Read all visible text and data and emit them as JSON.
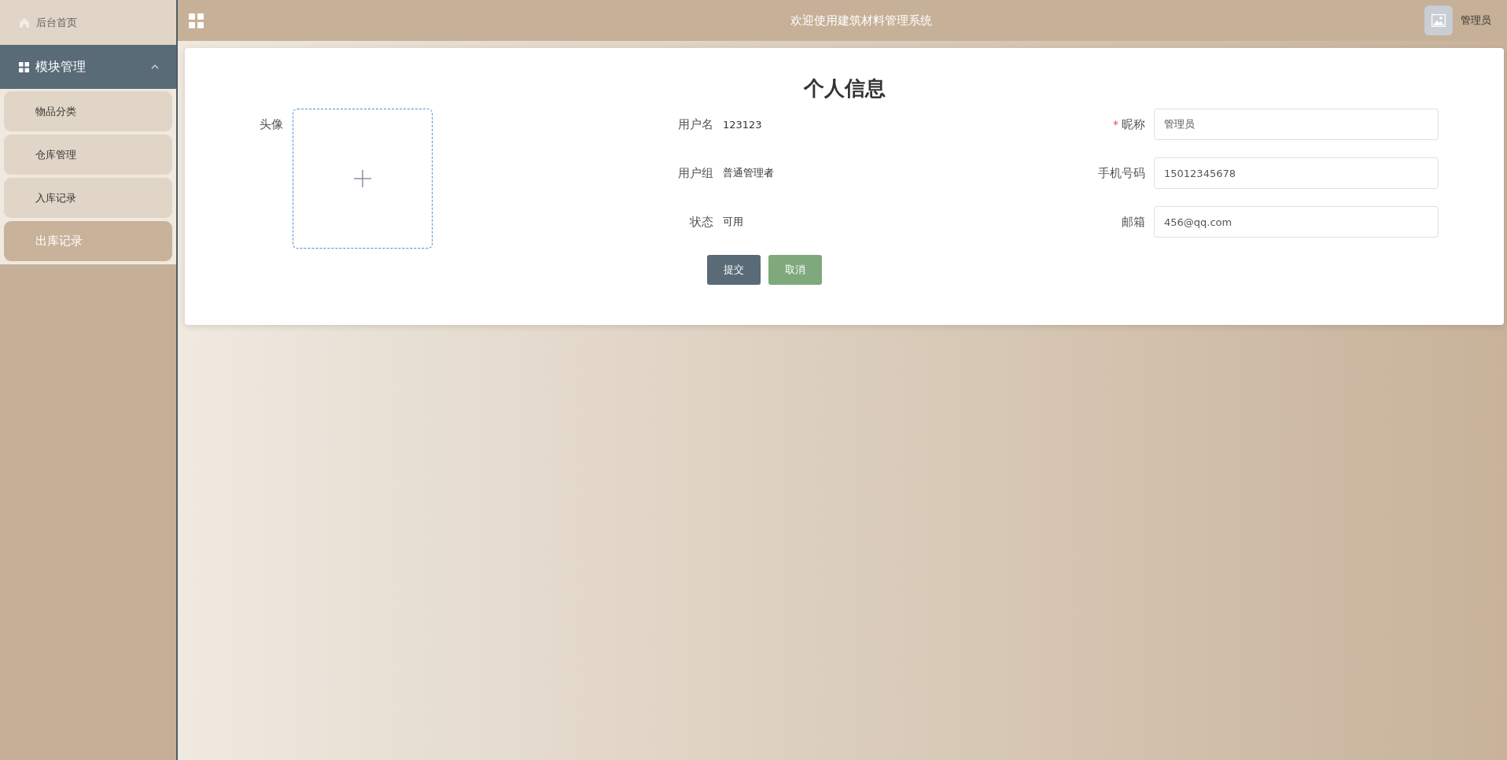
{
  "sidebar": {
    "home": {
      "label": "后台首页"
    },
    "group": {
      "label": "模块管理",
      "expanded": true,
      "items": [
        {
          "label": "物品分类",
          "selected": false
        },
        {
          "label": "仓库管理",
          "selected": false
        },
        {
          "label": "入库记录",
          "selected": false
        },
        {
          "label": "出库记录",
          "selected": true
        }
      ]
    }
  },
  "header": {
    "title": "欢迎使用建筑材料管理系统",
    "user": "管理员"
  },
  "card": {
    "title": "个人信息",
    "avatar": {
      "label": "头像"
    },
    "info": [
      {
        "label": "用户名",
        "value": "123123"
      },
      {
        "label": "用户组",
        "value": "普通管理者"
      },
      {
        "label": "状态",
        "value": "可用"
      }
    ],
    "fields": [
      {
        "label": "昵称",
        "mark": "*",
        "value": "管理员"
      },
      {
        "label": "手机号码",
        "value": "15012345678"
      },
      {
        "label": "邮箱",
        "value": "456@qq.com"
      }
    ],
    "buttons": [
      {
        "label": "提交",
        "kind": "primary"
      },
      {
        "label": "取消",
        "kind": "secondary"
      }
    ]
  }
}
